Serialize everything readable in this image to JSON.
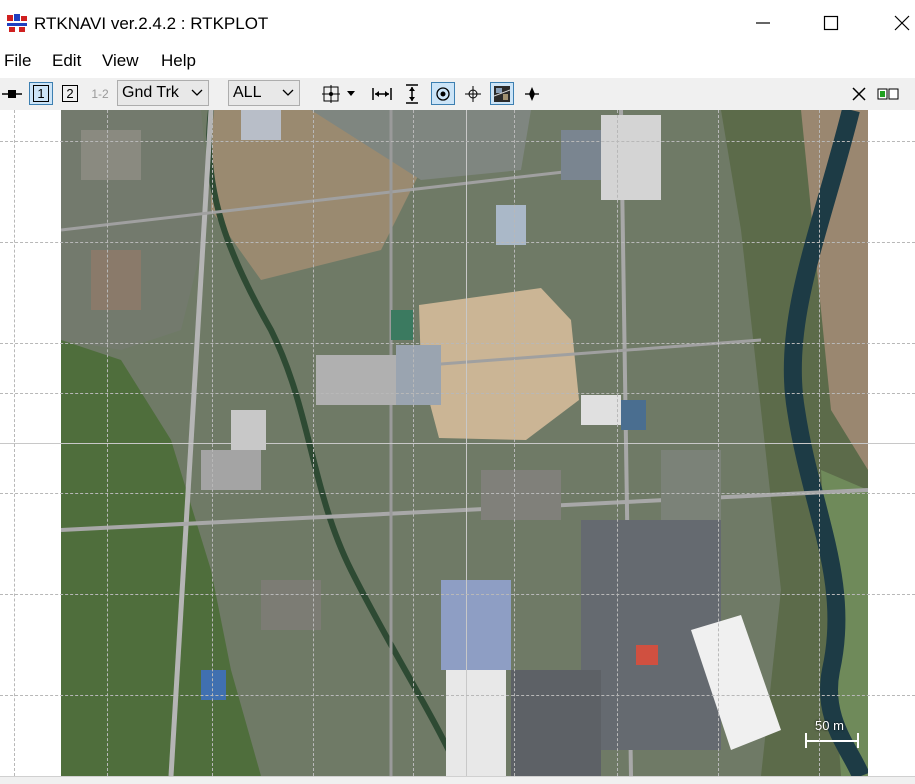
{
  "window": {
    "title": "RTKNAVI ver.2.4.2 : RTKPLOT",
    "icon": "rtklib-app-icon",
    "controls": [
      "minimize-icon",
      "maximize-icon",
      "close-icon"
    ]
  },
  "menu": {
    "items": [
      "File",
      "Edit",
      "View",
      "Help"
    ]
  },
  "toolbar": {
    "btn_1_label": "1",
    "btn_2_label": "2",
    "btn_12_label": "1-2",
    "plot_type": "Gnd Trk",
    "sat_select": "ALL",
    "icons": [
      "connect-icon",
      "center-origin-icon",
      "dropdown-arrow-icon",
      "fit-horizontal-icon",
      "fit-vertical-icon",
      "show-track-icon",
      "center-position-icon",
      "show-map-icon",
      "show-point-icon",
      "close-plot-icon",
      "status-icon"
    ]
  },
  "plot": {
    "scale_label": "50 m",
    "map_layer": "aerial-photo",
    "colors": {
      "grid": "#b8b8b8",
      "background": "#ffffff",
      "pressed": "#cce4f7"
    }
  }
}
